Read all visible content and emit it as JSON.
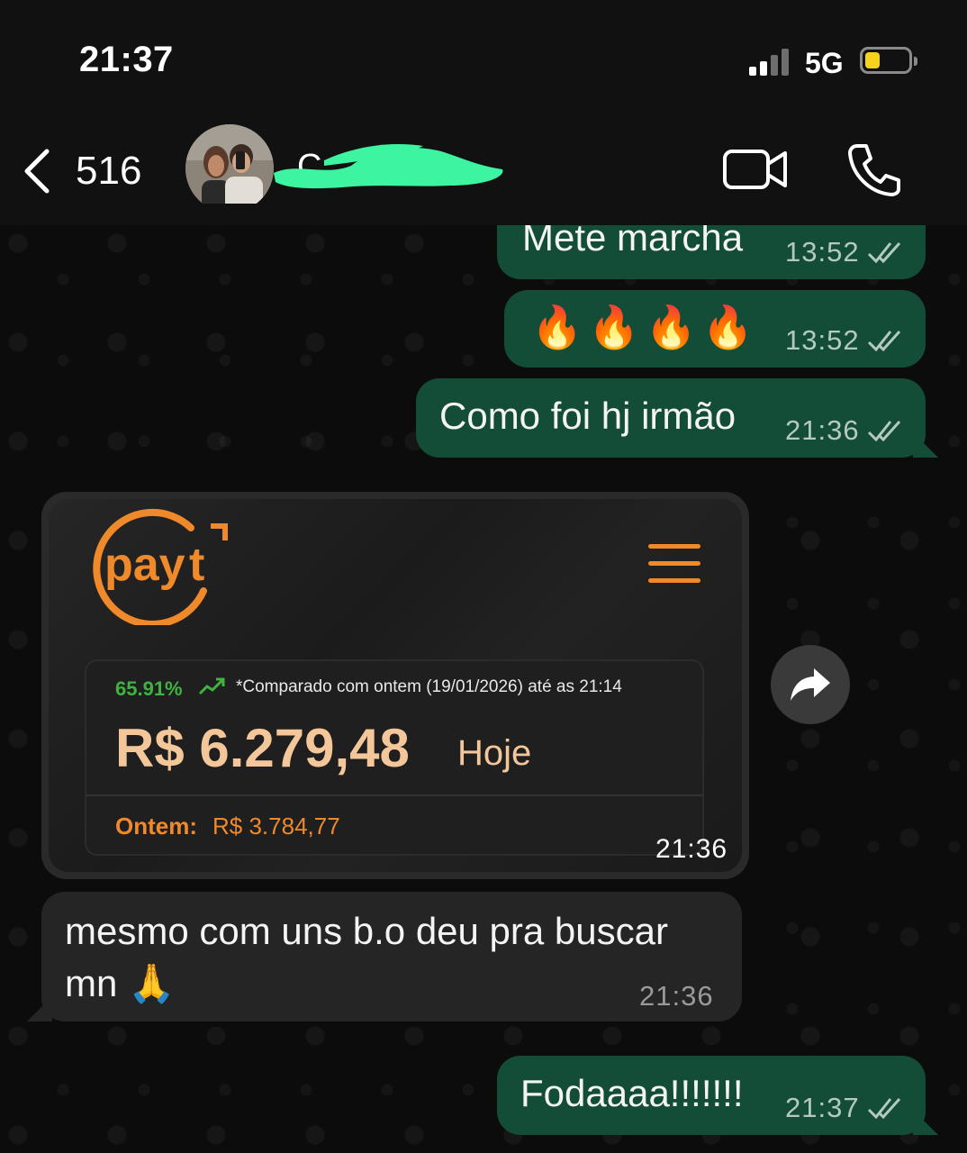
{
  "status_bar": {
    "time": "21:37",
    "network": "5G",
    "signal_bars_active": 2,
    "signal_bars_total": 4,
    "battery_level": 0.25,
    "battery_color": "#f7d21b"
  },
  "header": {
    "back_count": "516",
    "contact_name": "C",
    "icons": [
      "chevron-left-icon",
      "video-camera-icon",
      "phone-icon"
    ]
  },
  "messages": [
    {
      "direction": "out",
      "text": "Mete marcha",
      "time": "13:52",
      "status": "read"
    },
    {
      "direction": "out",
      "text": "🔥🔥🔥🔥",
      "time": "13:52",
      "status": "read"
    },
    {
      "direction": "out",
      "text": "Como foi hj irmão",
      "time": "21:36",
      "status": "read"
    },
    {
      "direction": "in",
      "type": "image",
      "time": "21:36",
      "image": {
        "brand": "payt",
        "percent_change": "65.91%",
        "comparison_note": "*Comparado com ontem (19/01/2026) até as 21:14",
        "amount_today": "R$ 6.279,48",
        "today_label": "Hoje",
        "yesterday_label": "Ontem:",
        "yesterday_amount": "R$ 3.784,77"
      }
    },
    {
      "direction": "in",
      "text_line1": "mesmo com uns b.o deu pra buscar",
      "text_line2": "mn 🙏",
      "time": "21:36"
    },
    {
      "direction": "out",
      "text": "Fodaaaa!!!!!!!",
      "time": "21:37",
      "status": "read"
    }
  ],
  "colors": {
    "outgoing_bubble": "#134d37",
    "incoming_bubble": "#252525",
    "accent_orange": "#f0892a",
    "positive_green": "#3fb23f",
    "redaction_green": "#3df5a0"
  }
}
